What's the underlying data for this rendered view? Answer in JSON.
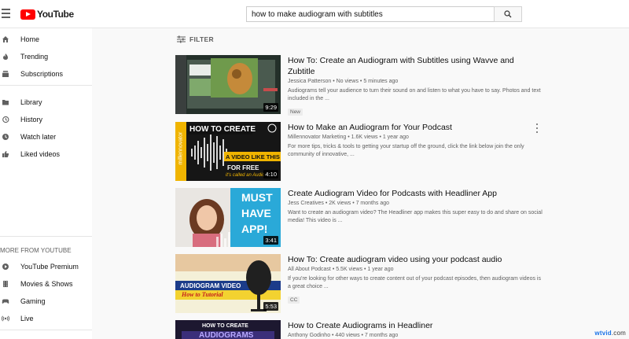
{
  "header": {
    "logo_text": "YouTube",
    "search_value": "how to make audiogram with subtitles"
  },
  "sidebar": {
    "items": [
      {
        "label": "Home",
        "icon": "home-icon"
      },
      {
        "label": "Trending",
        "icon": "flame-icon"
      },
      {
        "label": "Subscriptions",
        "icon": "subscriptions-icon"
      },
      {
        "label": "Library",
        "icon": "folder-icon"
      },
      {
        "label": "History",
        "icon": "history-icon"
      },
      {
        "label": "Watch later",
        "icon": "clock-icon"
      },
      {
        "label": "Liked videos",
        "icon": "thumb-up-icon"
      }
    ],
    "more_heading": "MORE FROM YOUTUBE",
    "more_items": [
      {
        "label": "YouTube Premium",
        "icon": "premium-icon"
      },
      {
        "label": "Movies & Shows",
        "icon": "film-icon"
      },
      {
        "label": "Gaming",
        "icon": "gamepad-icon"
      },
      {
        "label": "Live",
        "icon": "live-icon"
      }
    ]
  },
  "filter_label": "FILTER",
  "results": [
    {
      "title": "How To: Create an Audiogram with Subtitles using Wavve and Zubtitle",
      "channel": "Jessica Patterson",
      "meta": "Jessica Patterson • No views • 5 minutes ago",
      "description": "Audiograms tell your audience to turn their sound on and listen to what you have to say. Photos and text included in the ...",
      "badge": "New",
      "duration": "9:29"
    },
    {
      "title": "How to Make an Audiogram for Your Podcast",
      "meta": "Millennovator Marketing • 1.6K views • 1 year ago",
      "description": "For more tips, tricks & tools to getting your startup off the ground, click the link below join the only community of innovative, ...",
      "duration": "4:10",
      "thumb_text": {
        "line1": "HOW TO CREATE",
        "line2": "A VIDEO LIKE THIS",
        "line3": "FOR FREE",
        "line4": "it's called an Audio",
        "side": "millennovator"
      }
    },
    {
      "title": "Create Audiogram Video for Podcasts with Headliner App",
      "meta": "Jess Creatives • 2K views • 7 months ago",
      "description": "Want to create an audiogram video? The Headliner app makes this super easy to do and share on social media! This video is ...",
      "duration": "3:41",
      "thumb_text": {
        "line1": "MUST",
        "line2": "HAVE",
        "line3": "APP!"
      }
    },
    {
      "title": "How To: Create audiogram video using your podcast audio",
      "meta": "All About Podcast • 5.5K views • 1 year ago",
      "description": "If you're looking for other ways to create content out of your podcast episodes, then audiogram videos is a great choice ...",
      "badge": "CC",
      "duration": "5:53",
      "thumb_text": {
        "line1": "AUDIOGRAM VIDEO",
        "line2": "How to Tutorial"
      }
    },
    {
      "title": "How to Create Audiograms in Headliner",
      "meta": "Anthony Godinho • 440 views • 7 months ago",
      "thumb_text": {
        "line1": "HOW TO CREATE",
        "line2": "AUDIOGRAMS"
      }
    }
  ],
  "watermark": {
    "prefix": "wtvid",
    "suffix": ".com"
  },
  "colors": {
    "brand_red": "#ff0000",
    "text_secondary": "#606060",
    "bg": "#f9f9f9"
  }
}
